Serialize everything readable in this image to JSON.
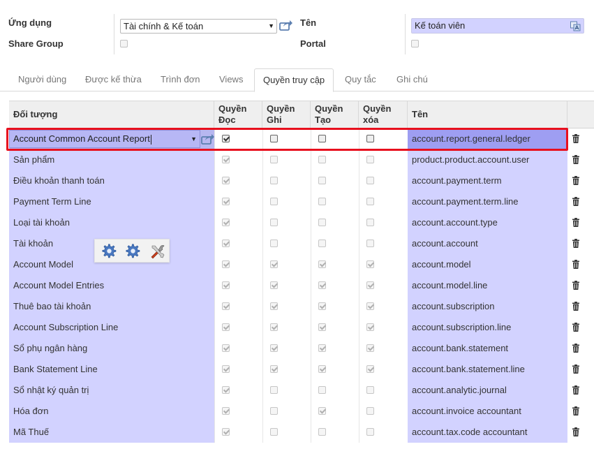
{
  "form": {
    "application_label": "Ứng dụng",
    "application_value": "Tài chính & Kế toán",
    "share_group_label": "Share Group",
    "share_group_checked": false,
    "name_label": "Tên",
    "name_value": "Kế toán viên",
    "portal_label": "Portal",
    "portal_checked": false
  },
  "tabs": [
    {
      "label": "Người dùng",
      "active": false
    },
    {
      "label": "Được kế thừa",
      "active": false
    },
    {
      "label": "Trình đơn",
      "active": false
    },
    {
      "label": "Views",
      "active": false
    },
    {
      "label": "Quyền truy cập",
      "active": true
    },
    {
      "label": "Quy tắc",
      "active": false
    },
    {
      "label": "Ghi chú",
      "active": false
    }
  ],
  "table": {
    "headers": {
      "object": "Đối tượng",
      "read": [
        "Quyền",
        "Đọc"
      ],
      "write": [
        "Quyền",
        "Ghi"
      ],
      "create": [
        "Quyền",
        "Tạo"
      ],
      "delete": [
        "Quyền",
        "xóa"
      ],
      "name": "Tên"
    },
    "editing_row": {
      "object": "Account Common Account Report",
      "read": true,
      "write": false,
      "create": false,
      "delete": false,
      "model": "account.report.general.ledger"
    },
    "rows": [
      {
        "object": "Sản phẩm",
        "read": true,
        "write": false,
        "create": false,
        "delete": false,
        "model": "product.product.account.user"
      },
      {
        "object": "Điều khoản thanh toán",
        "read": true,
        "write": false,
        "create": false,
        "delete": false,
        "model": "account.payment.term"
      },
      {
        "object": "Payment Term Line",
        "read": true,
        "write": false,
        "create": false,
        "delete": false,
        "model": "account.payment.term.line"
      },
      {
        "object": "Loại tài khoản",
        "read": true,
        "write": false,
        "create": false,
        "delete": false,
        "model": "account.account.type"
      },
      {
        "object": "Tài khoản",
        "read": true,
        "write": false,
        "create": false,
        "delete": false,
        "model": "account.account"
      },
      {
        "object": "Account Model",
        "read": true,
        "write": true,
        "create": true,
        "delete": true,
        "model": "account.model"
      },
      {
        "object": "Account Model Entries",
        "read": true,
        "write": true,
        "create": true,
        "delete": true,
        "model": "account.model.line"
      },
      {
        "object": "Thuê bao tài khoản",
        "read": true,
        "write": true,
        "create": true,
        "delete": true,
        "model": "account.subscription"
      },
      {
        "object": "Account Subscription Line",
        "read": true,
        "write": true,
        "create": true,
        "delete": true,
        "model": "account.subscription.line"
      },
      {
        "object": "Sổ phụ ngân hàng",
        "read": true,
        "write": true,
        "create": true,
        "delete": true,
        "model": "account.bank.statement"
      },
      {
        "object": "Bank Statement Line",
        "read": true,
        "write": true,
        "create": true,
        "delete": true,
        "model": "account.bank.statement.line"
      },
      {
        "object": "Sổ nhật ký quản trị",
        "read": true,
        "write": false,
        "create": false,
        "delete": false,
        "model": "account.analytic.journal"
      },
      {
        "object": "Hóa đơn",
        "read": true,
        "write": false,
        "create": true,
        "delete": false,
        "model": "account.invoice accountant"
      },
      {
        "object": "Mã Thuế",
        "read": true,
        "write": false,
        "create": false,
        "delete": false,
        "model": "account.tax.code accountant"
      }
    ]
  },
  "icons": {
    "external_link": "external-link-icon",
    "translate": "translate-icon",
    "delete": "trash-icon",
    "toolbar": [
      "gear-icon",
      "gear-icon",
      "tools-icon"
    ]
  },
  "colors": {
    "required_field": "#d2d2ff",
    "highlight_frame": "#e8101e"
  }
}
